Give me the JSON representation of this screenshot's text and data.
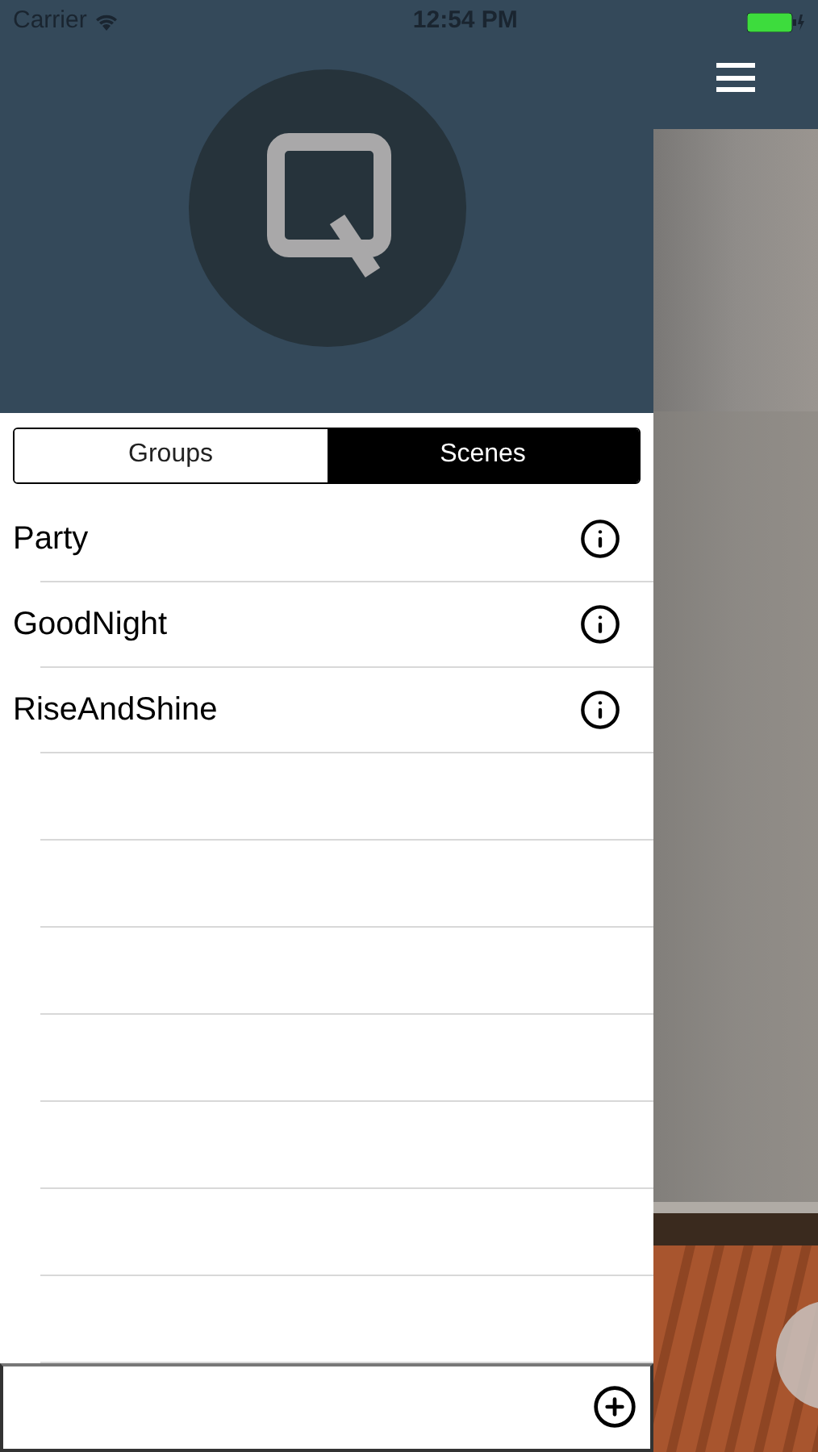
{
  "status_bar": {
    "carrier": "Carrier",
    "time": "12:54 PM"
  },
  "tabs": [
    {
      "label": "Groups",
      "selected": false
    },
    {
      "label": "Scenes",
      "selected": true
    }
  ],
  "scenes": [
    {
      "name": "Party"
    },
    {
      "name": "GoodNight"
    },
    {
      "name": "RiseAndShine"
    }
  ]
}
